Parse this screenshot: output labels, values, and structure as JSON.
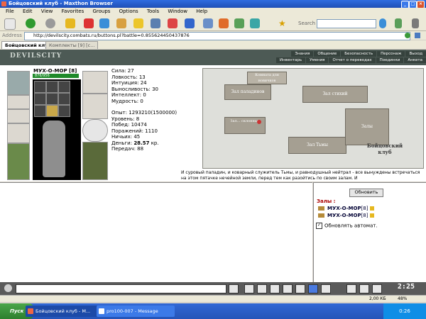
{
  "window": {
    "title": "Бойцовский клуб - Maxthon Browser",
    "controls": {
      "minimize": "_",
      "maximize": "□",
      "close": "×"
    }
  },
  "menu": [
    "File",
    "Edit",
    "View",
    "Favorites",
    "Groups",
    "Options",
    "Tools",
    "Window",
    "Help"
  ],
  "toolbar": {
    "search_label": "Search",
    "favorites_star": "★"
  },
  "address": {
    "label": "Address",
    "url": "http://devilscity.combats.ru/buttons.pl?battle=0.855624450437876"
  },
  "tabs": [
    {
      "label": "Бойцовский клуб"
    },
    {
      "label": "Комплекты [9] [c..."
    }
  ],
  "game_header": {
    "logo": "DEVILSCITY",
    "nav_top": [
      "Знания",
      "Общение",
      "Безопасность",
      "Персонаж",
      "Выход"
    ],
    "nav_bottom": [
      "Инвентарь",
      "Умения",
      "Отчет о переводах",
      "Поединки",
      "Анкета"
    ]
  },
  "character": {
    "name": "МУХ-О-МОР",
    "level": "[8]",
    "hp": "876/956",
    "stats": [
      "Сила: 27",
      "Ловкость: 13",
      "Интуиция: 24",
      "Выносливость: 30",
      "Интеллект: 0",
      "Мудрость: 0"
    ],
    "record": [
      "Опыт: 1293210(1500000)",
      "Уровень: 8",
      "Побед: 10474",
      "Поражений: 1110",
      "Ничьих: 45"
    ],
    "money_label": "Деньги:",
    "money_value": "28.57",
    "money_unit": "кр.",
    "transfers": "Передач: 88"
  },
  "map": {
    "buildings": [
      {
        "name": "Зал паладинов"
      },
      {
        "name": "Зал стихий"
      },
      {
        "name": "Комната для новичков"
      },
      {
        "name": "Зал Тьмы"
      },
      {
        "name": "Залы"
      },
      {
        "name": "Бойцовский клуб"
      },
      {
        "name": "Зал... склонных"
      }
    ]
  },
  "story_text": "И суровый паладин, и коварный служитель Тьмы, и равнодушный нейтрал - все вынуждены встречаться на этом пятачке нечейной земли, перед тем как разойтись по своим залам. И",
  "side": {
    "refresh_label": "Обновить",
    "rooms_label": "Залы :",
    "users": [
      {
        "name": "МУХ-О-МОР",
        "level": "[8]"
      },
      {
        "name": "МУХ-О-МОР",
        "level": "[8]"
      }
    ],
    "auto_label": "Обновлять автомат.",
    "auto_checked": "✓"
  },
  "chatbar": {
    "clock": "2:25"
  },
  "statusbar": {
    "download_size": "2,00 КБ",
    "percent": "48%"
  },
  "taskbar": {
    "start": "Пуск",
    "tasks": [
      "Бойцовский клуб - M...",
      "pro100-007 - Message"
    ],
    "tray_time": "0:26"
  },
  "colors": {
    "title_blue": "#1f4fb6",
    "game_header": "#4d5a55",
    "hp_green": "#1f8a2a",
    "rooms_red": "#aa0000"
  }
}
